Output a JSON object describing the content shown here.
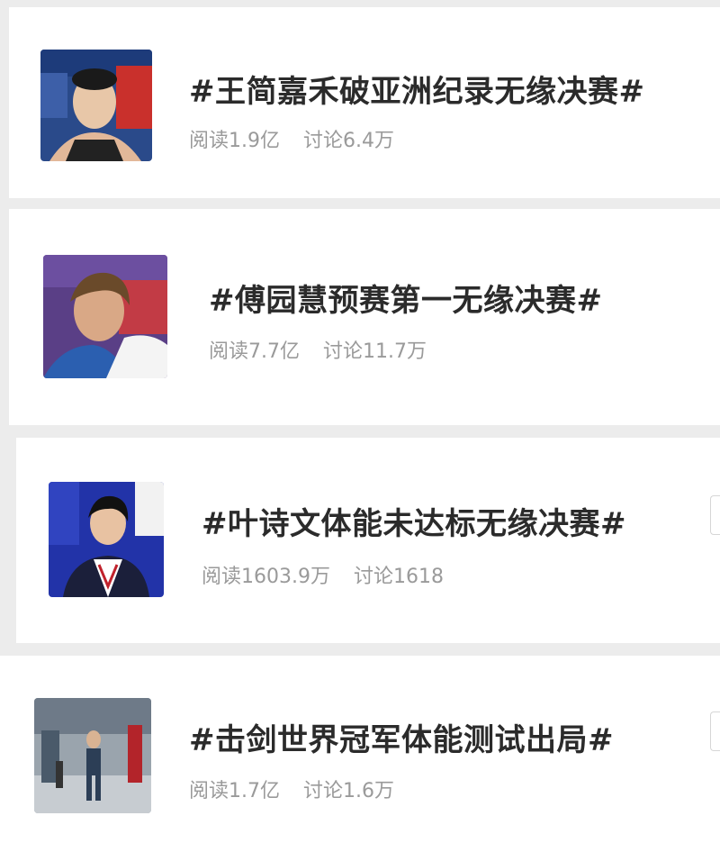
{
  "topics": [
    {
      "title": "#王简嘉禾破亚洲纪录无缘决赛#",
      "reads": "阅读1.9亿",
      "discussions": "讨论6.4万"
    },
    {
      "title": "#傅园慧预赛第一无缘决赛#",
      "reads": "阅读7.7亿",
      "discussions": "讨论11.7万"
    },
    {
      "title": "#叶诗文体能未达标无缘决赛#",
      "reads": "阅读1603.9万",
      "discussions": "讨论1618"
    },
    {
      "title": "#击剑世界冠军体能测试出局#",
      "reads": "阅读1.7亿",
      "discussions": "讨论1.6万"
    }
  ],
  "colors": {
    "title": "#2b2b2b",
    "meta": "#9a9a9a",
    "card": "#ffffff",
    "background": "#ececec"
  }
}
